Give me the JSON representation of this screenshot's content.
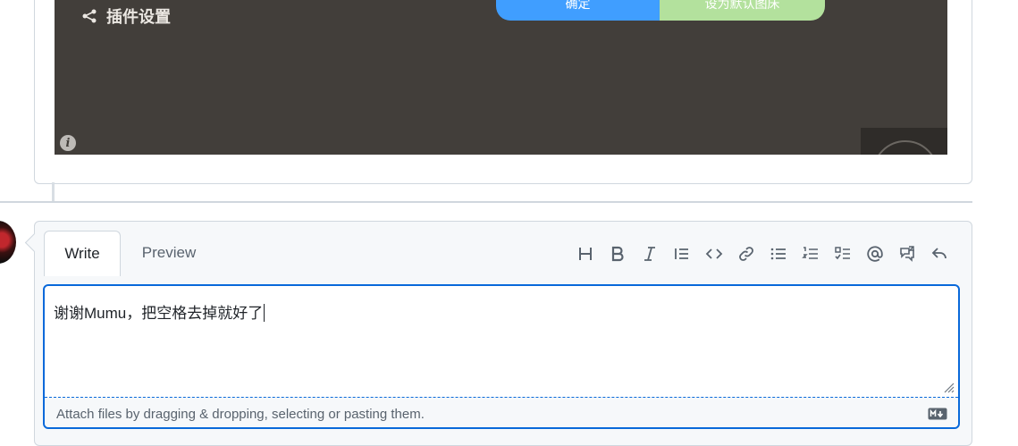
{
  "screenshot": {
    "plugin_settings_label": "插件设置",
    "confirm_button": "确定",
    "set_default_button": "设为默认图床"
  },
  "editor": {
    "tabs": [
      {
        "label": "Write",
        "selected": true
      },
      {
        "label": "Preview",
        "selected": false
      }
    ],
    "toolbar": [
      {
        "icon": "heading-icon",
        "label": "H"
      },
      {
        "icon": "bold-icon"
      },
      {
        "icon": "italic-icon"
      },
      {
        "icon": "quote-icon"
      },
      {
        "icon": "code-icon"
      },
      {
        "icon": "link-icon"
      },
      {
        "icon": "unordered-list-icon"
      },
      {
        "icon": "ordered-list-icon"
      },
      {
        "icon": "task-list-icon"
      },
      {
        "icon": "mention-icon"
      },
      {
        "icon": "cross-reference-icon"
      },
      {
        "icon": "saved-replies-icon"
      }
    ],
    "text_value": "谢谢Mumu，把空格去掉就好了",
    "attach_hint": "Attach files by dragging & dropping, selecting or pasting them.",
    "accent_color": "#0969da"
  }
}
